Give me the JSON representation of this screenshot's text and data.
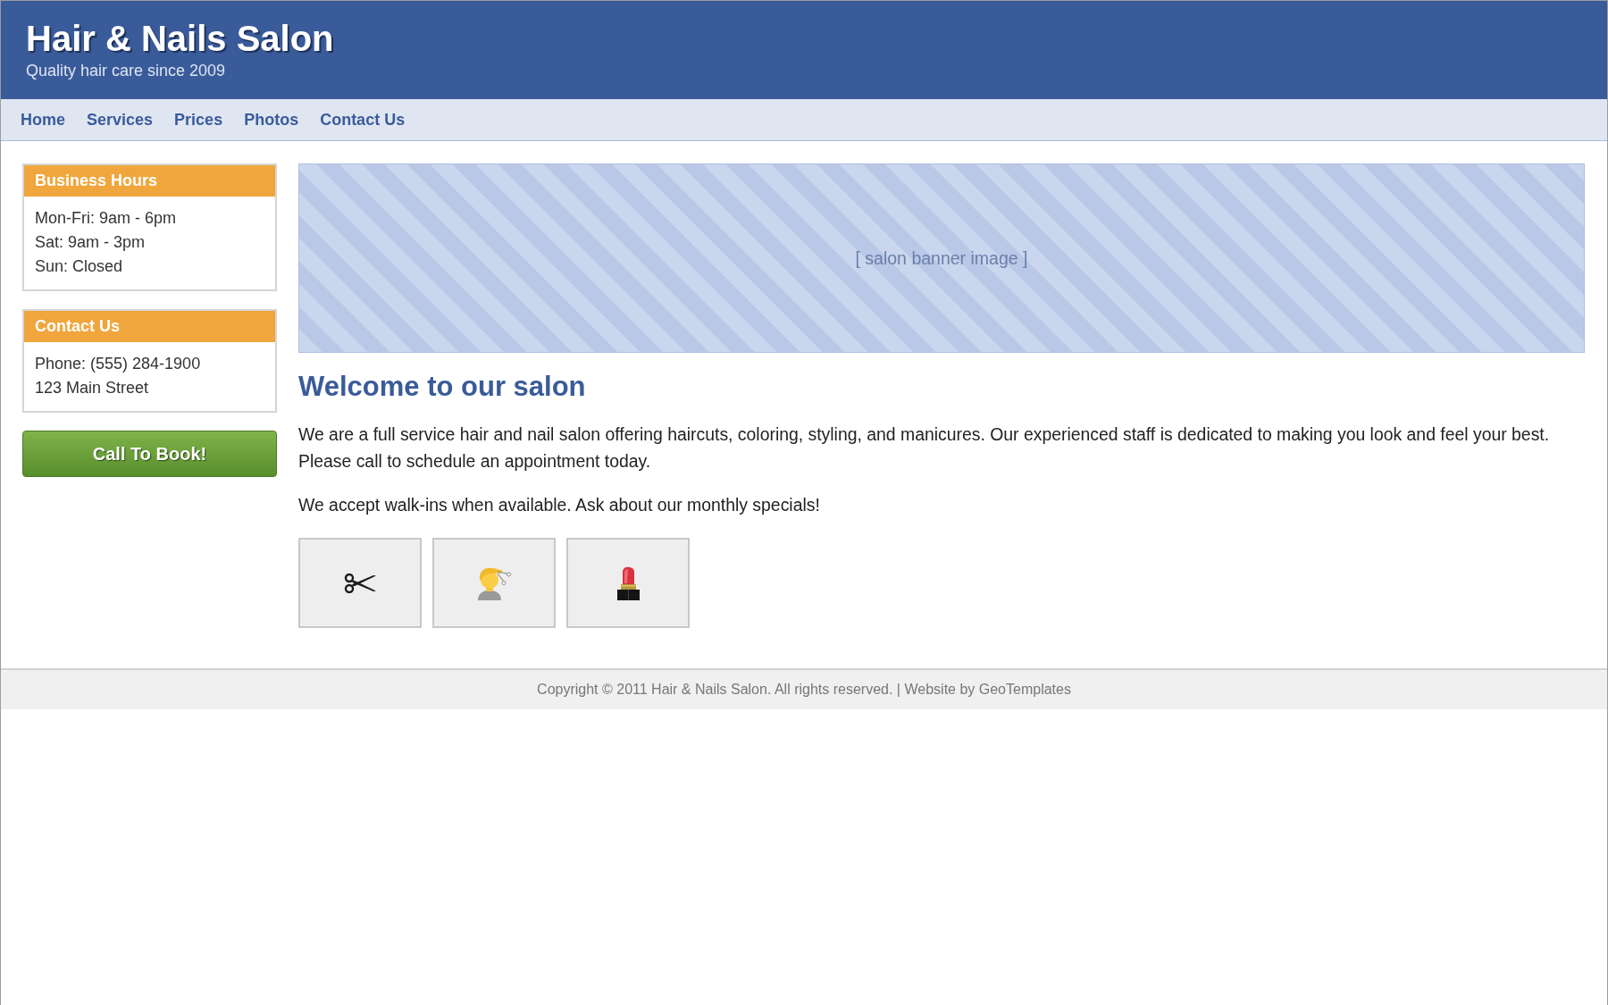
{
  "header": {
    "title": "Hair & Nails Salon",
    "tagline": "Quality hair care since 2009"
  },
  "nav": [
    "Home",
    "Services",
    "Prices",
    "Photos",
    "Contact Us"
  ],
  "sidebar": {
    "boxes": [
      {
        "title": "Business Hours",
        "lines": [
          "Mon-Fri: 9am - 6pm",
          "Sat: 9am - 3pm",
          "Sun: Closed"
        ]
      },
      {
        "title": "Contact Us",
        "lines": [
          "Phone: (555) 284-1900",
          "123 Main Street"
        ]
      }
    ],
    "button": "Call To Book!"
  },
  "banner": {
    "caption": "[ salon banner image ]"
  },
  "content": {
    "heading": "Welcome to our salon",
    "paragraphs": [
      "We are a full service hair and nail salon offering haircuts, coloring, styling, and manicures. Our experienced staff is dedicated to making you look and feel your best. Please call to schedule an appointment today.",
      "We accept walk-ins when available. Ask about our monthly specials!"
    ]
  },
  "gallery": [
    {
      "kind": "scissors"
    },
    {
      "kind": "haircut"
    },
    {
      "kind": "lipstick"
    }
  ],
  "footer": "Copyright © 2011 Hair & Nails Salon. All rights reserved. | Website by GeoTemplates"
}
